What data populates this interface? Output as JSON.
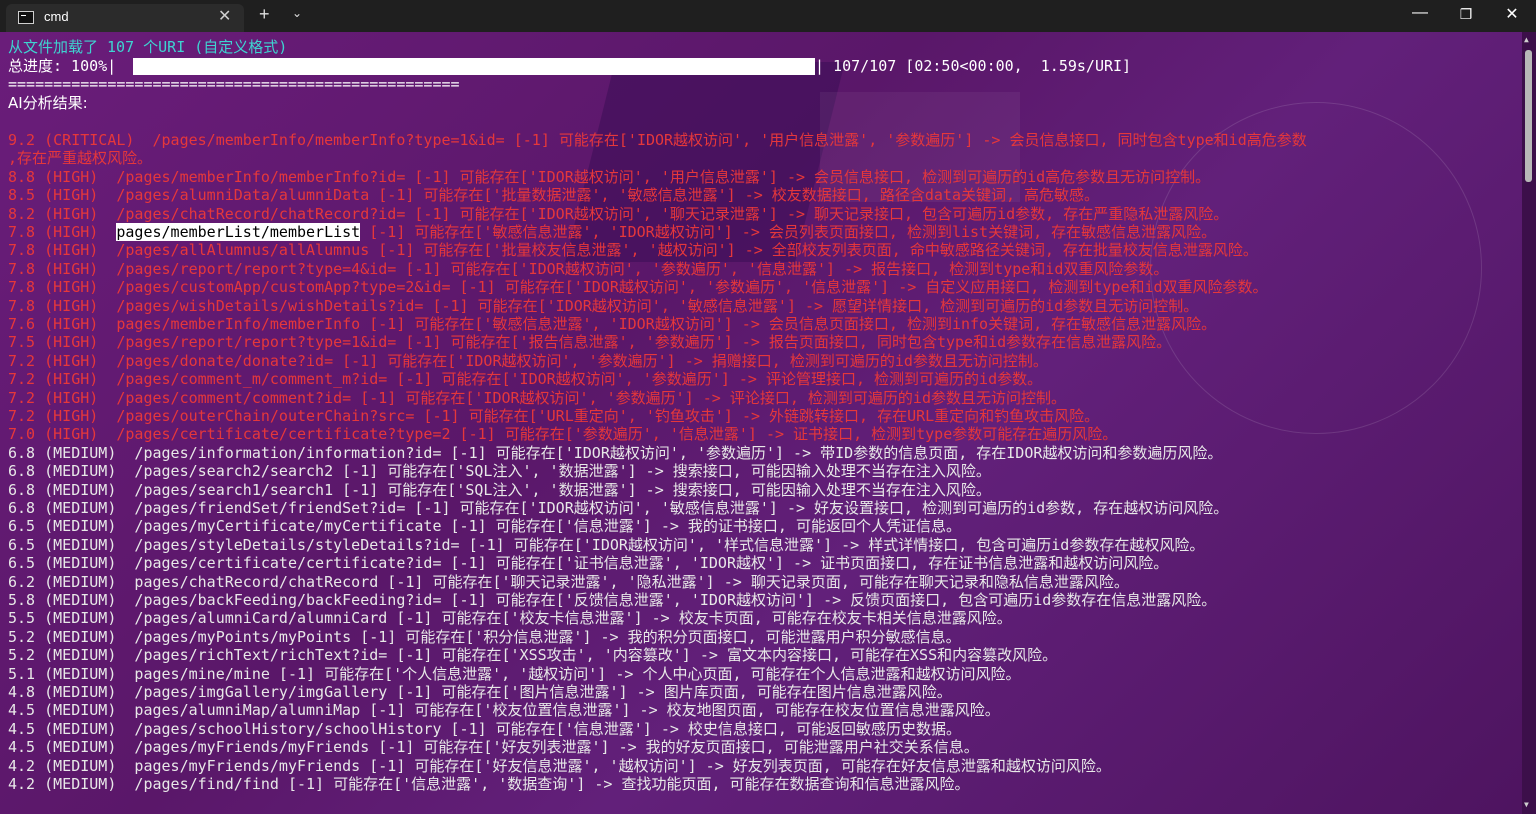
{
  "window": {
    "tab_title": "cmd",
    "close_tab": "✕",
    "new_tab": "+",
    "tab_menu": "⌄",
    "minimize": "—",
    "maximize": "❐",
    "close": "✕"
  },
  "terminal": {
    "loaded_line": "从文件加载了 107 个URI (自定义格式)",
    "progress_label": "总进度: 100%|",
    "progress_fraction": 1.0,
    "progress_tail": "| 107/107 [02:50<00:00,  1.59s/URI]",
    "separator": "==================================================",
    "ai_header": "AI分析结果:",
    "results": [
      {
        "line": "9.2 (CRITICAL)  /pages/memberInfo/memberInfo?type=1&id= [-1] 可能存在['IDOR越权访问', '用户信息泄露', '参数遍历'] -> 会员信息接口, 同时包含type和id高危参数",
        "level": "high"
      },
      {
        "line": ",存在严重越权风险。",
        "level": "high"
      },
      {
        "line": "8.8 (HIGH)  /pages/memberInfo/memberInfo?id= [-1] 可能存在['IDOR越权访问', '用户信息泄露'] -> 会员信息接口, 检测到可遍历的id高危参数且无访问控制。",
        "level": "high"
      },
      {
        "line": "8.5 (HIGH)  /pages/alumniData/alumniData [-1] 可能存在['批量数据泄露', '敏感信息泄露'] -> 校友数据接口, 路径含data关键词, 高危敏感。",
        "level": "high"
      },
      {
        "line": "8.2 (HIGH)  /pages/chatRecord/chatRecord?id= [-1] 可能存在['IDOR越权访问', '聊天记录泄露'] -> 聊天记录接口, 包含可遍历id参数, 存在严重隐私泄露风险。",
        "level": "high"
      },
      {
        "line": "7.8 (HIGH)  ",
        "hl": "pages/memberList/memberList",
        "rest": " [-1] 可能存在['敏感信息泄露', 'IDOR越权访问'] -> 会员列表页面接口, 检测到list关键词, 存在敏感信息泄露风险。",
        "level": "high"
      },
      {
        "line": "7.8 (HIGH)  /pages/allAlumnus/allAlumnus [-1] 可能存在['批量校友信息泄露', '越权访问'] -> 全部校友列表页面, 命中敏感路径关键词, 存在批量校友信息泄露风险。",
        "level": "high"
      },
      {
        "line": "7.8 (HIGH)  /pages/report/report?type=4&id= [-1] 可能存在['IDOR越权访问', '参数遍历', '信息泄露'] -> 报告接口, 检测到type和id双重风险参数。",
        "level": "high"
      },
      {
        "line": "7.8 (HIGH)  /pages/customApp/customApp?type=2&id= [-1] 可能存在['IDOR越权访问', '参数遍历', '信息泄露'] -> 自定义应用接口, 检测到type和id双重风险参数。",
        "level": "high"
      },
      {
        "line": "7.8 (HIGH)  /pages/wishDetails/wishDetails?id= [-1] 可能存在['IDOR越权访问', '敏感信息泄露'] -> 愿望详情接口, 检测到可遍历的id参数且无访问控制。",
        "level": "high"
      },
      {
        "line": "7.6 (HIGH)  pages/memberInfo/memberInfo [-1] 可能存在['敏感信息泄露', 'IDOR越权访问'] -> 会员信息页面接口, 检测到info关键词, 存在敏感信息泄露风险。",
        "level": "high"
      },
      {
        "line": "7.5 (HIGH)  /pages/report/report?type=1&id= [-1] 可能存在['报告信息泄露', '参数遍历'] -> 报告页面接口, 同时包含type和id参数存在信息泄露风险。",
        "level": "high"
      },
      {
        "line": "7.2 (HIGH)  /pages/donate/donate?id= [-1] 可能存在['IDOR越权访问', '参数遍历'] -> 捐赠接口, 检测到可遍历的id参数且无访问控制。",
        "level": "high"
      },
      {
        "line": "7.2 (HIGH)  /pages/comment_m/comment_m?id= [-1] 可能存在['IDOR越权访问', '参数遍历'] -> 评论管理接口, 检测到可遍历的id参数。",
        "level": "high"
      },
      {
        "line": "7.2 (HIGH)  /pages/comment/comment?id= [-1] 可能存在['IDOR越权访问', '参数遍历'] -> 评论接口, 检测到可遍历的id参数且无访问控制。",
        "level": "high"
      },
      {
        "line": "7.2 (HIGH)  /pages/outerChain/outerChain?src= [-1] 可能存在['URL重定向', '钓鱼攻击'] -> 外链跳转接口, 存在URL重定向和钓鱼攻击风险。",
        "level": "high"
      },
      {
        "line": "7.0 (HIGH)  /pages/certificate/certificate?type=2 [-1] 可能存在['参数遍历', '信息泄露'] -> 证书接口, 检测到type参数可能存在遍历风险。",
        "level": "high"
      },
      {
        "line": "6.8 (MEDIUM)  /pages/information/information?id= [-1] 可能存在['IDOR越权访问', '参数遍历'] -> 带ID参数的信息页面, 存在IDOR越权访问和参数遍历风险。",
        "level": "medium"
      },
      {
        "line": "6.8 (MEDIUM)  /pages/search2/search2 [-1] 可能存在['SQL注入', '数据泄露'] -> 搜索接口, 可能因输入处理不当存在注入风险。",
        "level": "medium"
      },
      {
        "line": "6.8 (MEDIUM)  /pages/search1/search1 [-1] 可能存在['SQL注入', '数据泄露'] -> 搜索接口, 可能因输入处理不当存在注入风险。",
        "level": "medium"
      },
      {
        "line": "6.8 (MEDIUM)  /pages/friendSet/friendSet?id= [-1] 可能存在['IDOR越权访问', '敏感信息泄露'] -> 好友设置接口, 检测到可遍历的id参数, 存在越权访问风险。",
        "level": "medium"
      },
      {
        "line": "6.5 (MEDIUM)  /pages/myCertificate/myCertificate [-1] 可能存在['信息泄露'] -> 我的证书接口, 可能返回个人凭证信息。",
        "level": "medium"
      },
      {
        "line": "6.5 (MEDIUM)  /pages/styleDetails/styleDetails?id= [-1] 可能存在['IDOR越权访问', '样式信息泄露'] -> 样式详情接口, 包含可遍历id参数存在越权风险。",
        "level": "medium"
      },
      {
        "line": "6.5 (MEDIUM)  /pages/certificate/certificate?id= [-1] 可能存在['证书信息泄露', 'IDOR越权'] -> 证书页面接口, 存在证书信息泄露和越权访问风险。",
        "level": "medium"
      },
      {
        "line": "6.2 (MEDIUM)  pages/chatRecord/chatRecord [-1] 可能存在['聊天记录泄露', '隐私泄露'] -> 聊天记录页面, 可能存在聊天记录和隐私信息泄露风险。",
        "level": "medium"
      },
      {
        "line": "5.8 (MEDIUM)  /pages/backFeeding/backFeeding?id= [-1] 可能存在['反馈信息泄露', 'IDOR越权访问'] -> 反馈页面接口, 包含可遍历id参数存在信息泄露风险。",
        "level": "medium"
      },
      {
        "line": "5.5 (MEDIUM)  /pages/alumniCard/alumniCard [-1] 可能存在['校友卡信息泄露'] -> 校友卡页面, 可能存在校友卡相关信息泄露风险。",
        "level": "medium"
      },
      {
        "line": "5.2 (MEDIUM)  /pages/myPoints/myPoints [-1] 可能存在['积分信息泄露'] -> 我的积分页面接口, 可能泄露用户积分敏感信息。",
        "level": "medium"
      },
      {
        "line": "5.2 (MEDIUM)  /pages/richText/richText?id= [-1] 可能存在['XSS攻击', '内容篡改'] -> 富文本内容接口, 可能存在XSS和内容篡改风险。",
        "level": "medium"
      },
      {
        "line": "5.1 (MEDIUM)  pages/mine/mine [-1] 可能存在['个人信息泄露', '越权访问'] -> 个人中心页面, 可能存在个人信息泄露和越权访问风险。",
        "level": "medium"
      },
      {
        "line": "4.8 (MEDIUM)  /pages/imgGallery/imgGallery [-1] 可能存在['图片信息泄露'] -> 图片库页面, 可能存在图片信息泄露风险。",
        "level": "medium"
      },
      {
        "line": "4.5 (MEDIUM)  pages/alumniMap/alumniMap [-1] 可能存在['校友位置信息泄露'] -> 校友地图页面, 可能存在校友位置信息泄露风险。",
        "level": "medium"
      },
      {
        "line": "4.5 (MEDIUM)  /pages/schoolHistory/schoolHistory [-1] 可能存在['信息泄露'] -> 校史信息接口, 可能返回敏感历史数据。",
        "level": "medium"
      },
      {
        "line": "4.5 (MEDIUM)  /pages/myFriends/myFriends [-1] 可能存在['好友列表泄露'] -> 我的好友页面接口, 可能泄露用户社交关系信息。",
        "level": "medium"
      },
      {
        "line": "4.2 (MEDIUM)  pages/myFriends/myFriends [-1] 可能存在['好友信息泄露', '越权访问'] -> 好友列表页面, 可能存在好友信息泄露和越权访问风险。",
        "level": "medium"
      },
      {
        "line": "4.2 (MEDIUM)  /pages/find/find [-1] 可能存在['信息泄露', '数据查询'] -> 查找功能页面, 可能存在数据查询和信息泄露风险。",
        "level": "medium"
      }
    ]
  },
  "colors": {
    "high": "#e5373b",
    "medium": "#e8e8e8",
    "cyan": "#3fd3d0"
  }
}
